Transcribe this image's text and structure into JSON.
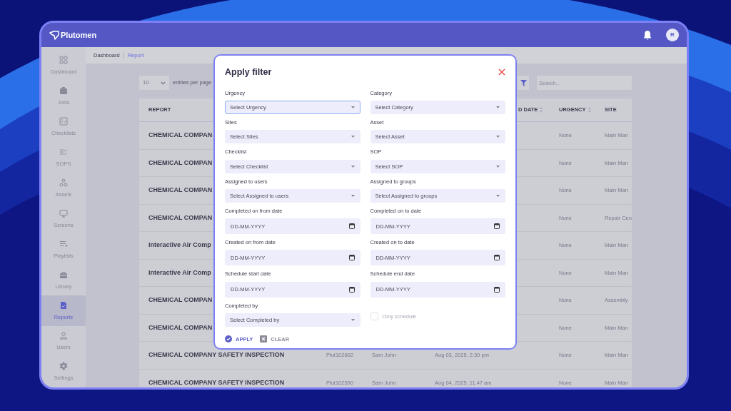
{
  "app": {
    "logo": "Plutomen",
    "avatar": "R"
  },
  "sidebar": {
    "items": [
      {
        "label": "Dashboard",
        "selected": false
      },
      {
        "label": "Jobs",
        "selected": false
      },
      {
        "label": "Checklists",
        "selected": false
      },
      {
        "label": "SOPS",
        "selected": false
      },
      {
        "label": "Assets",
        "selected": false
      },
      {
        "label": "Screens",
        "selected": false
      },
      {
        "label": "Playlists",
        "selected": false
      },
      {
        "label": "Library",
        "selected": false
      },
      {
        "label": "Reports",
        "selected": true
      },
      {
        "label": "Users",
        "selected": false
      },
      {
        "label": "Settings",
        "selected": false
      }
    ]
  },
  "breadcrumb": [
    {
      "label": "Dashboard",
      "current": false
    },
    {
      "label": "Report",
      "current": true
    }
  ],
  "toolbar": {
    "page_size": "10",
    "page_size_label": "entries per page",
    "search_placeholder": "Search..."
  },
  "table": {
    "columns": [
      {
        "label": "REPORT",
        "sortable": false
      },
      {
        "label": "D DATE",
        "sortable": true
      },
      {
        "label": "URGENCY",
        "sortable": true
      },
      {
        "label": "SITE",
        "sortable": false
      }
    ],
    "rows": [
      {
        "report": "CHEMICAL COMPAN",
        "urgency": "None",
        "site": "Main Man"
      },
      {
        "report": "CHEMICAL COMPAN",
        "urgency": "None",
        "site": "Main Man"
      },
      {
        "report": "CHEMICAL COMPAN",
        "urgency": "None",
        "site": "Main Man"
      },
      {
        "report": "CHEMICAL COMPAN",
        "urgency": "None",
        "site": "Repair Cen"
      },
      {
        "report": "Interactive Air Comp",
        "urgency": "None",
        "site": "Main Man"
      },
      {
        "report": "Interactive Air Comp",
        "urgency": "None",
        "site": "Main Man"
      },
      {
        "report": "CHEMICAL COMPAN",
        "urgency": "None",
        "site": "Assembly"
      },
      {
        "report": "CHEMICAL COMPAN",
        "urgency": "None",
        "site": "Main Man"
      },
      {
        "report": "CHEMICAL COMPANY SAFETY INSPECTION",
        "id": "Plut102602",
        "user": "Sam John",
        "date": "Aug 03, 2025, 2:30 pm",
        "urgency": "None",
        "site": "Main Man"
      },
      {
        "report": "CHEMICAL COMPANY SAFETY INSPECTION",
        "id": "Plut102590",
        "user": "Sam John",
        "date": "Aug 04, 2025, 11:47 am",
        "urgency": "None",
        "site": "Main Man"
      }
    ]
  },
  "modal": {
    "title": "Apply filter",
    "fields": [
      {
        "kind": "select",
        "label": "Urgency",
        "placeholder": "Select Urgency",
        "focused": true
      },
      {
        "kind": "select",
        "label": "Category",
        "placeholder": "Select Category",
        "focused": false
      },
      {
        "kind": "select",
        "label": "Sites",
        "placeholder": "Select Sites",
        "focused": false
      },
      {
        "kind": "select",
        "label": "Asset",
        "placeholder": "Select Asset",
        "focused": false
      },
      {
        "kind": "select",
        "label": "Checklist",
        "placeholder": "Select Checklist",
        "focused": false
      },
      {
        "kind": "select",
        "label": "SOP",
        "placeholder": "Select SOP",
        "focused": false
      },
      {
        "kind": "select",
        "label": "Assigned to users",
        "placeholder": "Select Assigned to users",
        "focused": false
      },
      {
        "kind": "select",
        "label": "Assigned to groups",
        "placeholder": "Select Assigned to groups",
        "focused": false
      },
      {
        "kind": "date",
        "label": "Completed on from date",
        "placeholder": "DD-MM-YYYY",
        "focused": false
      },
      {
        "kind": "date",
        "label": "Completed on to date",
        "placeholder": "DD-MM-YYYY",
        "focused": false
      },
      {
        "kind": "date",
        "label": "Created on from date",
        "placeholder": "DD-MM-YYYY",
        "focused": false
      },
      {
        "kind": "date",
        "label": "Created on to date",
        "placeholder": "DD-MM-YYYY",
        "focused": false
      },
      {
        "kind": "date",
        "label": "Schedule start date",
        "placeholder": "DD-MM-YYYY",
        "focused": false
      },
      {
        "kind": "date",
        "label": "Schedule end date",
        "placeholder": "DD-MM-YYYY",
        "focused": false
      },
      {
        "kind": "select",
        "label": "Completed by",
        "placeholder": "Select Completed by",
        "focused": false
      },
      {
        "kind": "checkbox",
        "label": "Only schedule",
        "checked": false,
        "disabled": true
      }
    ],
    "buttons": [
      {
        "label": "APPLY",
        "kind": "primary"
      },
      {
        "label": "CLEAR",
        "kind": "secondary"
      }
    ]
  }
}
